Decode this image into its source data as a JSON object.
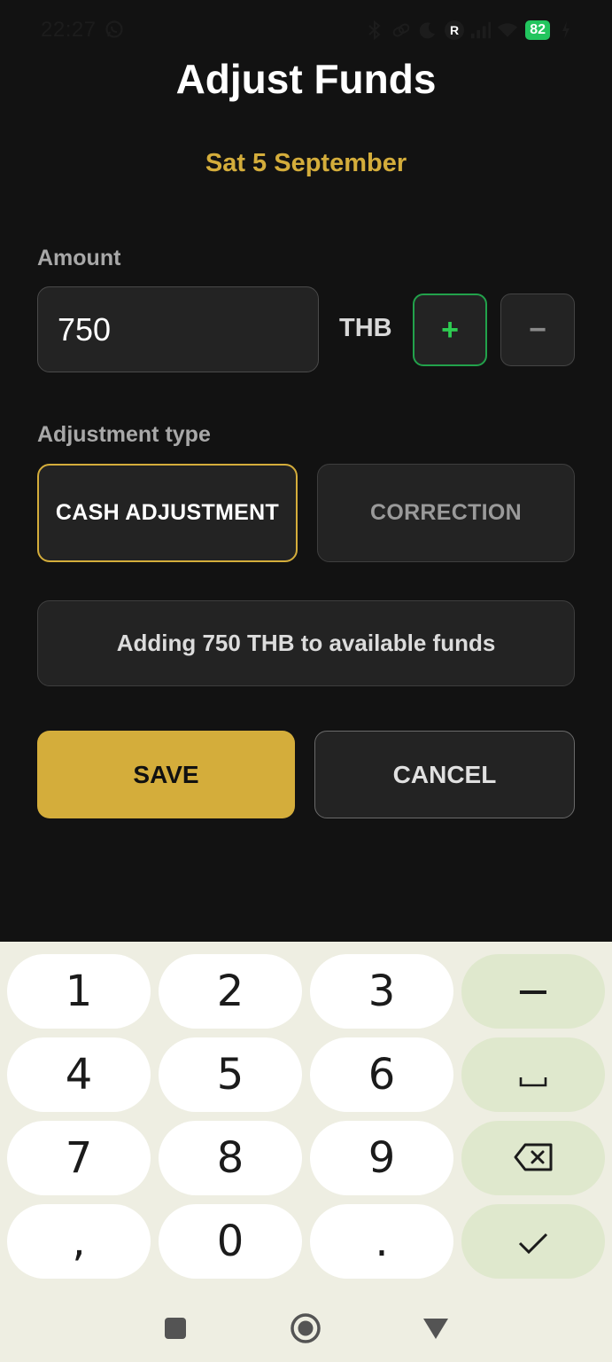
{
  "status_bar": {
    "time": "22:27",
    "battery": "82"
  },
  "page": {
    "title": "Adjust Funds",
    "date": "Sat 5 September"
  },
  "amount": {
    "label": "Amount",
    "value": "750",
    "currency": "THB",
    "plus_label": "+",
    "minus_label": "−"
  },
  "adjustment": {
    "label": "Adjustment type",
    "options": [
      "CASH ADJUSTMENT",
      "CORRECTION"
    ],
    "selected": "CASH ADJUSTMENT"
  },
  "summary": {
    "text": "Adding 750 THB to available funds"
  },
  "actions": {
    "save_label": "SAVE",
    "cancel_label": "CANCEL"
  },
  "keyboard": {
    "keys": [
      "1",
      "2",
      "3",
      "4",
      "5",
      "6",
      "7",
      "8",
      "9",
      ",",
      "0",
      "."
    ],
    "minus_key": "−"
  },
  "colors": {
    "background": "#121212",
    "accent": "#d4ad3b",
    "plus_green": "#22a24b",
    "keyboard_bg": "#eeeee2",
    "keyboard_fn": "#dfe8cd"
  },
  "icons": {
    "status": [
      "whatsapp-icon",
      "bluetooth-icon",
      "link-icon",
      "moon-icon",
      "registered-icon",
      "signal-icon",
      "wifi-icon",
      "battery-icon",
      "charging-icon"
    ],
    "keyboard": [
      "space-icon",
      "backspace-icon",
      "check-icon"
    ],
    "nav": [
      "recents-square-icon",
      "home-circle-icon",
      "back-triangle-icon"
    ]
  }
}
